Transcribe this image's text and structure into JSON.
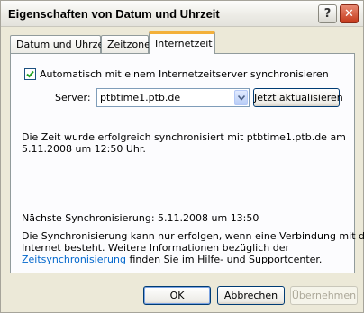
{
  "window": {
    "title": "Eigenschaften von Datum und Uhrzeit",
    "help_glyph": "?",
    "close_glyph": "✕"
  },
  "tabs": [
    {
      "label": "Datum und Uhrzeit"
    },
    {
      "label": "Zeitzone"
    },
    {
      "label": "Internetzeit"
    }
  ],
  "internet_time": {
    "sync_checkbox_label": "Automatisch mit einem Internetzeitserver synchronisieren",
    "sync_checked": true,
    "server_label": "Server:",
    "server_value": "ptbtime1.ptb.de",
    "update_button": "Jetzt aktualisieren",
    "status_line1": "Die Zeit wurde erfolgreich synchronisiert mit ptbtime1.ptb.de am",
    "status_line2": "5.11.2008 um 12:50 Uhr.",
    "next_sync": "Nächste Synchronisierung: 5.11.2008 um 13:50",
    "info_line1": "Die Synchronisierung kann nur erfolgen, wenn eine Verbindung mit dem",
    "info_line2": "Internet besteht. Weitere Informationen bezüglich der",
    "info_link": "Zeitsynchronisierung",
    "info_line3_rest": " finden Sie im Hilfe- und Supportcenter."
  },
  "footer": {
    "ok": "OK",
    "cancel": "Abbrechen",
    "apply": "Übernehmen"
  },
  "colors": {
    "window_bg": "#ece9d8",
    "active_tab_accent": "#f3b03b",
    "link": "#0066cc",
    "close_button": "#c5391b"
  }
}
